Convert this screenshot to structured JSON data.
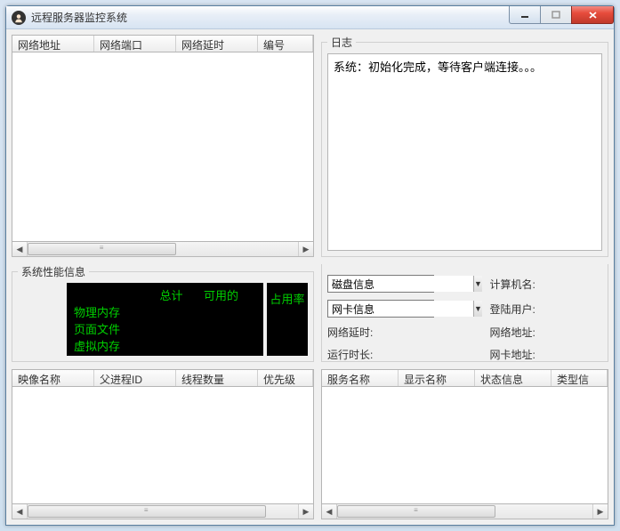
{
  "window": {
    "title": "远程服务器监控系统"
  },
  "connections": {
    "columns": [
      "网络地址",
      "网络端口",
      "网络延时",
      "编号"
    ]
  },
  "log": {
    "legend": "日志",
    "lines": [
      "系统：初始化完成，等待客户端连接。。。"
    ]
  },
  "perf": {
    "legend": "系统性能信息",
    "headers": {
      "total": "总计",
      "available": "可用的",
      "rate": "占用率"
    },
    "rows": [
      "物理内存",
      "页面文件",
      "虚拟内存"
    ]
  },
  "info": {
    "diskCombo": "磁盘信息",
    "nicCombo": "网卡信息",
    "labels": {
      "computer": "计算机名:",
      "user": "登陆用户:",
      "netDelay": "网络延时:",
      "netAddr": "网络地址:",
      "uptime": "运行时长:",
      "nicAddr": "网卡地址:"
    }
  },
  "processes": {
    "columns": [
      "映像名称",
      "父进程ID",
      "线程数量",
      "优先级"
    ]
  },
  "services": {
    "columns": [
      "服务名称",
      "显示名称",
      "状态信息",
      "类型信"
    ]
  }
}
